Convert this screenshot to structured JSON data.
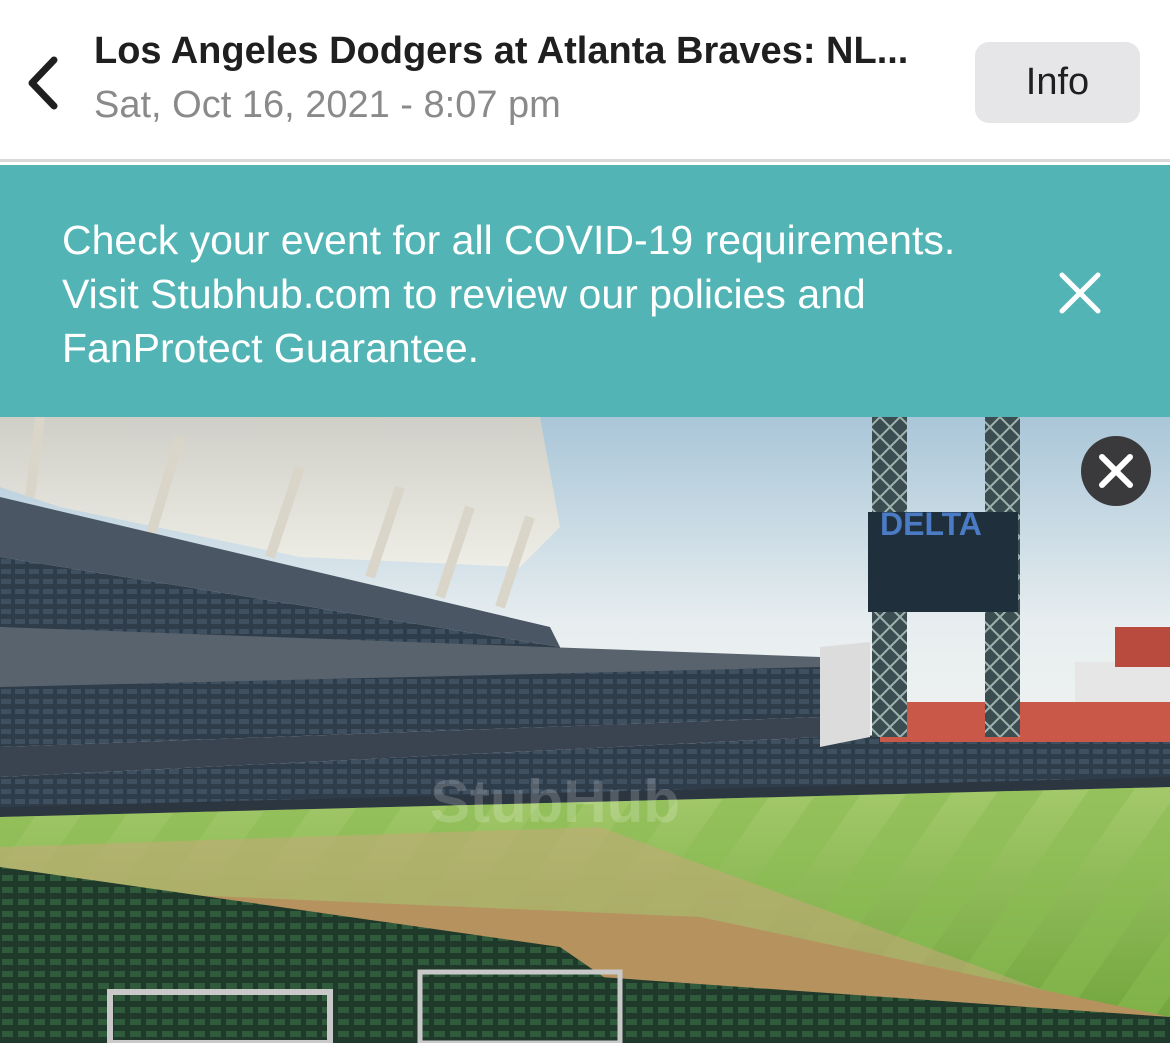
{
  "header": {
    "back_icon": "chevron-left-icon",
    "event_title": "Los Angeles Dodgers at Atlanta Braves: NL...",
    "event_datetime": "Sat, Oct 16, 2021 - 8:07 pm",
    "info_label": "Info"
  },
  "banner": {
    "message": "Check your event for all COVID-19 requirements. Visit Stubhub.com to review our policies and FanProtect Guarantee.",
    "close_icon": "close-icon",
    "background_color": "#52b4b4"
  },
  "stadium_view": {
    "scoreboard_text": "DELTA",
    "watermark_text": "StubHub",
    "close_icon": "close-circle-icon"
  }
}
